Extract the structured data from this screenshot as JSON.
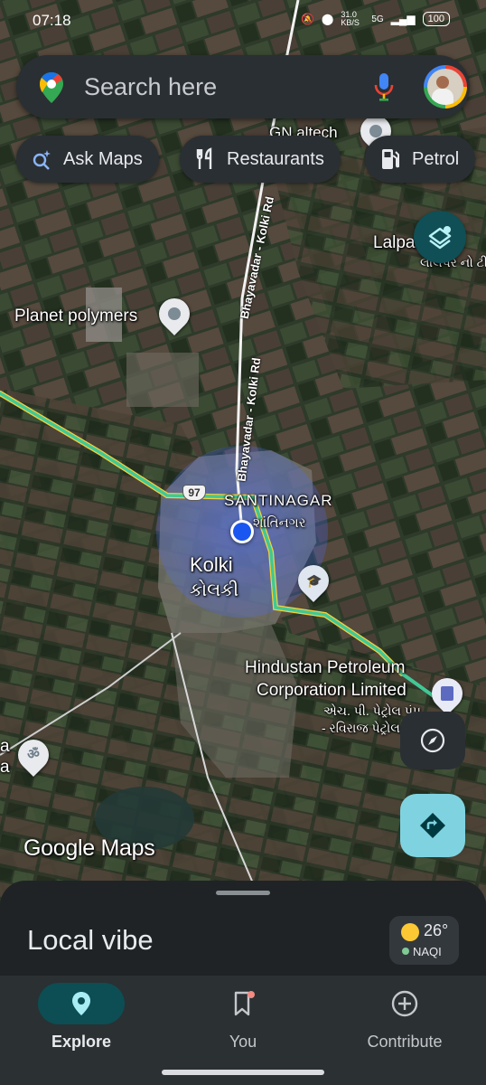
{
  "status_bar": {
    "time": "07:18",
    "network_speed": "31.0 KB/S",
    "network_type": "5G",
    "battery": "100"
  },
  "search": {
    "placeholder": "Search here"
  },
  "chips": [
    {
      "label": "Ask Maps",
      "icon": "sparkle-search-icon"
    },
    {
      "label": "Restaurants",
      "icon": "fork-knife-icon"
    },
    {
      "label": "Petrol",
      "icon": "fuel-pump-icon"
    }
  ],
  "map": {
    "places": {
      "gn_altech": "GN altech",
      "lalpar": "Lalpar",
      "lalpar_gujarati": "લાલપર નો ટી",
      "planet_polymers": "Planet polymers",
      "santinagar": "SANTINAGAR",
      "santinagar_gujarati": "શાંતિનગર",
      "kolki": "Kolki",
      "kolki_gujarati": "કોલકી",
      "hindustan_line1": "Hindustan Petroleum",
      "hindustan_line2": "Corporation Limited",
      "hp_gujarati_1": "એચ. પી. પેટ્રોલ પંપ",
      "hp_gujarati_2": "- રવિરાજ પેટ્રોલ",
      "left_edge_1": "a",
      "left_edge_2": "a"
    },
    "roads": {
      "bhayavadar_1": "Bhayavadar - Kolki Rd",
      "bhayavadar_2": "Bhayavadar - Kolki Rd",
      "highway_shield": "97"
    },
    "logo": "Google Maps"
  },
  "bottom_sheet": {
    "title": "Local vibe",
    "weather": {
      "temperature": "26°",
      "aqi_label": "NAQI"
    }
  },
  "nav": [
    {
      "label": "Explore",
      "icon": "pin-icon",
      "active": true
    },
    {
      "label": "You",
      "icon": "bookmark-icon",
      "active": false
    },
    {
      "label": "Contribute",
      "icon": "plus-circle-icon",
      "active": false
    }
  ],
  "colors": {
    "road_green": "#41c896",
    "road_yellow": "#f5d23c",
    "location_blue": "#1a56f0",
    "active_nav": "#0c4e53",
    "directions": "#7fd3e0"
  }
}
